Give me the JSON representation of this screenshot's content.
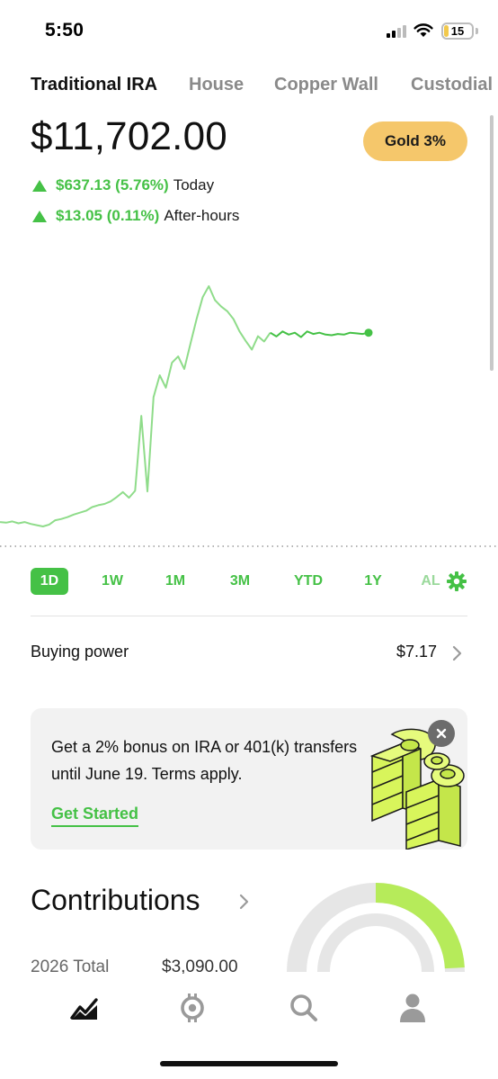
{
  "status_bar": {
    "time": "5:50",
    "battery": "15",
    "battery_level": 0.15
  },
  "accounts": {
    "tabs": [
      {
        "label": "Traditional IRA",
        "active": true
      },
      {
        "label": "House",
        "active": false
      },
      {
        "label": "Copper Wall",
        "active": false
      },
      {
        "label": "Custodial",
        "active": false
      }
    ]
  },
  "portfolio": {
    "balance": "$11,702.00",
    "badge": "Gold 3%",
    "today": {
      "amount": "$637.13 (5.76%)",
      "label": "Today"
    },
    "after_hours": {
      "amount": "$13.05 (0.11%)",
      "label": "After-hours"
    }
  },
  "chart_data": {
    "type": "line",
    "title": "",
    "xlabel": "",
    "ylabel": "",
    "grid": false,
    "baseline": "dotted",
    "color": "#45c146",
    "x": [
      0,
      1,
      2,
      3,
      4,
      5,
      6,
      7,
      8,
      9,
      10,
      11,
      12,
      13,
      14,
      15,
      16,
      17,
      18,
      19,
      20,
      21,
      22,
      23,
      24,
      25,
      26,
      27,
      28,
      29,
      30,
      31,
      32,
      33,
      34,
      35,
      36,
      37,
      38,
      39,
      40,
      41,
      42,
      43,
      44,
      45,
      46,
      47,
      48,
      49,
      50,
      51,
      52,
      53,
      54,
      55,
      56,
      57,
      58,
      59,
      60
    ],
    "values": [
      11070,
      11068,
      11072,
      11066,
      11070,
      11064,
      11060,
      11056,
      11062,
      11076,
      11080,
      11086,
      11094,
      11100,
      11106,
      11118,
      11124,
      11128,
      11136,
      11150,
      11166,
      11148,
      11170,
      11410,
      11168,
      11470,
      11540,
      11500,
      11580,
      11600,
      11560,
      11640,
      11720,
      11790,
      11825,
      11780,
      11760,
      11745,
      11720,
      11680,
      11650,
      11622,
      11665,
      11648,
      11676,
      11664,
      11680,
      11670,
      11676,
      11662,
      11680,
      11672,
      11676,
      11670,
      11668,
      11672,
      11670,
      11676,
      11674,
      11672,
      11676
    ],
    "regular_hours_end_index": 44,
    "last_point": 11676
  },
  "ranges": {
    "items": [
      {
        "label": "1D",
        "active": true
      },
      {
        "label": "1W",
        "active": false
      },
      {
        "label": "1M",
        "active": false
      },
      {
        "label": "3M",
        "active": false
      },
      {
        "label": "YTD",
        "active": false
      },
      {
        "label": "1Y",
        "active": false
      },
      {
        "label": "AL",
        "active": false
      }
    ],
    "settings_icon": "gear-icon"
  },
  "buying_power": {
    "label": "Buying power",
    "value": "$7.17"
  },
  "promo": {
    "text": "Get a 2% bonus on IRA or 401(k) transfers until June 19. Terms apply.",
    "cta": "Get Started",
    "art_color": "#d8f55b"
  },
  "contributions": {
    "title": "Contributions",
    "year_label": "2026 Total",
    "total": "$3,090.00",
    "progress_fraction": 0.22,
    "accent": "#b6eb5a",
    "track": "#e6e6e6"
  },
  "nav": {
    "items": [
      {
        "icon": "investing-chart-icon",
        "active": true
      },
      {
        "icon": "crypto-icon",
        "active": false
      },
      {
        "icon": "search-icon",
        "active": false
      },
      {
        "icon": "account-person-icon",
        "active": false
      }
    ]
  }
}
